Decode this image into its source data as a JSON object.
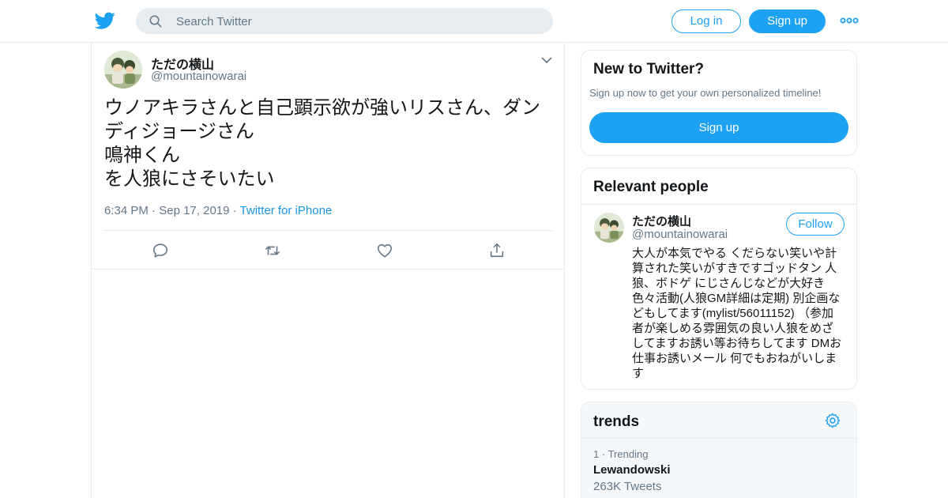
{
  "colors": {
    "accent": "#1da1f2",
    "link": "#1b95e0",
    "secondary_text": "#657786",
    "border": "#e6ecf0"
  },
  "header": {
    "logo_icon": "twitter-bird-icon",
    "search_placeholder": "Search Twitter",
    "login_label": "Log in",
    "signup_label": "Sign up",
    "more_icon": "more-dots-icon"
  },
  "tweet": {
    "name": "ただの横山",
    "handle": "@mountainowarai",
    "text_lines": [
      "ウノアキラさんと自己顕示欲が強いリスさん、ダン",
      "ディジョージさん",
      "鳴神くん",
      "を人狼にさそいたい"
    ],
    "time": "6:34 PM",
    "date": "Sep 17, 2019",
    "source": "Twitter for iPhone",
    "separator": "·",
    "actions": [
      "reply-icon",
      "retweet-icon",
      "like-icon",
      "share-icon"
    ]
  },
  "new_to_twitter": {
    "title": "New to Twitter?",
    "subtitle": "Sign up now to get your own personalized timeline!",
    "signup_label": "Sign up"
  },
  "relevant_people": {
    "title": "Relevant people",
    "name": "ただの横山",
    "handle": "@mountainowarai",
    "follow_label": "Follow",
    "bio_lines": [
      "大人が本気でやる くだらない笑いや計",
      "算された笑いがすきですゴッドタン 人",
      "狼、ボドゲ にじさんじなどが大好き",
      "色々活動(人狼GM詳細は定期) 別企画な",
      "どもしてます(mylist/56011152) （参加",
      "者が楽しめる雰囲気の良い人狼をめざ",
      "してますお誘い等お待ちしてます DMお",
      "仕事お誘いメール 何でもおねがいしま",
      "す"
    ]
  },
  "trends": {
    "title": "trends",
    "gear_icon": "gear-icon",
    "items": [
      {
        "rank": "1",
        "separator": "·",
        "context": "Trending",
        "name": "Lewandowski",
        "count": "263K Tweets"
      }
    ]
  }
}
